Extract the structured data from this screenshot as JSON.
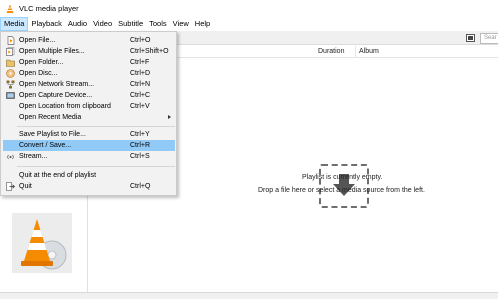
{
  "window": {
    "title": "VLC media player",
    "icon": "vlc-cone-icon"
  },
  "menubar": {
    "items": [
      "Media",
      "Playback",
      "Audio",
      "Video",
      "Subtitle",
      "Tools",
      "View",
      "Help"
    ],
    "active": "Media"
  },
  "media_menu": {
    "items": [
      {
        "label": "Open File...",
        "shortcut": "Ctrl+O",
        "icon": "open-file-icon"
      },
      {
        "label": "Open Multiple Files...",
        "shortcut": "Ctrl+Shift+O",
        "icon": "open-multiple-files-icon"
      },
      {
        "label": "Open Folder...",
        "shortcut": "Ctrl+F",
        "icon": "folder-icon"
      },
      {
        "label": "Open Disc...",
        "shortcut": "Ctrl+D",
        "icon": "disc-icon"
      },
      {
        "label": "Open Network Stream...",
        "shortcut": "Ctrl+N",
        "icon": "network-icon"
      },
      {
        "label": "Open Capture Device...",
        "shortcut": "Ctrl+C",
        "icon": "capture-device-icon"
      },
      {
        "label": "Open Location from clipboard",
        "shortcut": "Ctrl+V"
      },
      {
        "label": "Open Recent Media",
        "submenu": true
      },
      {
        "label": "Save Playlist to File...",
        "shortcut": "Ctrl+Y"
      },
      {
        "label": "Convert / Save...",
        "shortcut": "Ctrl+R",
        "highlighted": true
      },
      {
        "label": "Stream...",
        "shortcut": "Ctrl+S",
        "icon": "stream-icon"
      },
      {
        "label": "Quit at the end of playlist"
      },
      {
        "label": "Quit",
        "shortcut": "Ctrl+Q",
        "icon": "quit-icon"
      }
    ]
  },
  "toolbar": {
    "search_placeholder": "Sear"
  },
  "playlist": {
    "columns": [
      "Duration",
      "Album"
    ],
    "empty_message": "Playlist is currently empty.",
    "empty_hint": "Drop a file here or select a media source from the left."
  },
  "colors": {
    "menu_highlight": "#91c9f7",
    "menubar_active": "#cce8ff",
    "vlc_orange": "#f48b00"
  }
}
